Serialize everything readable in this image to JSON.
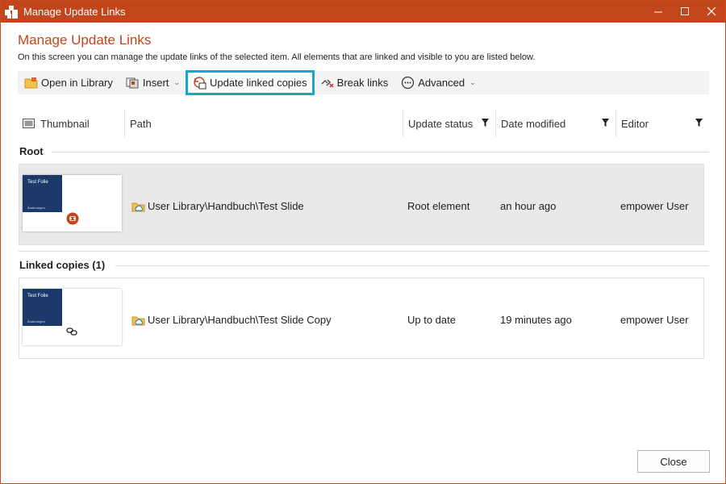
{
  "window": {
    "title": "Manage Update Links"
  },
  "header": {
    "heading": "Manage Update Links",
    "description": "On this screen you can manage the update links of the selected item. All elements that are linked and visible to you are listed below."
  },
  "toolbar": {
    "open_in_library": "Open in Library",
    "insert": "Insert",
    "update_linked_copies": "Update linked copies",
    "break_links": "Break links",
    "advanced": "Advanced"
  },
  "columns": {
    "thumbnail": "Thumbnail",
    "path": "Path",
    "update_status": "Update status",
    "date_modified": "Date modified",
    "editor": "Editor"
  },
  "groups": {
    "root": {
      "label": "Root",
      "item": {
        "thumb_title": "Test Folie",
        "thumb_subtitle": "Ãnderungen",
        "path": "User Library\\Handbuch\\Test Slide",
        "status": "Root element",
        "date": "an hour ago",
        "editor": "empower User"
      }
    },
    "linked": {
      "label": "Linked copies (1)",
      "item": {
        "thumb_title": "Test Folie",
        "thumb_subtitle": "Ãnderungen",
        "path": "User Library\\Handbuch\\Test Slide Copy",
        "status": "Up to date",
        "date": "19 minutes ago",
        "editor": "empower User"
      }
    }
  },
  "footer": {
    "close": "Close"
  },
  "colors": {
    "accent": "#c3451c",
    "highlight": "#16a6cf",
    "thumb_blue": "#1b3a6b"
  }
}
